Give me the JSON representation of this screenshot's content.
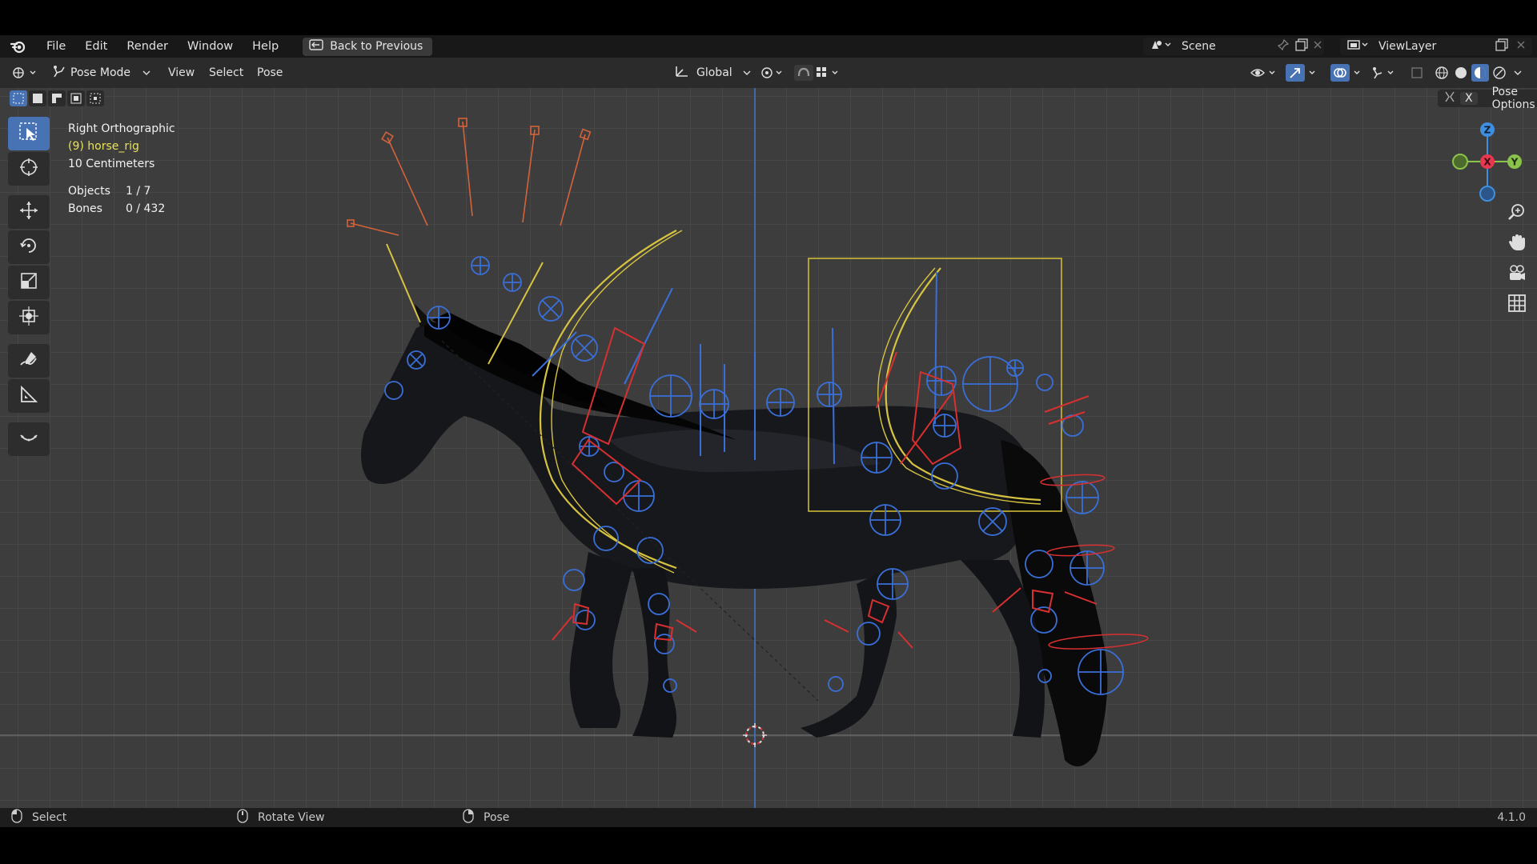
{
  "menubar": {
    "items": [
      "File",
      "Edit",
      "Render",
      "Window",
      "Help"
    ],
    "back_button": "Back to Previous",
    "scene": "Scene",
    "view_layer": "ViewLayer"
  },
  "header": {
    "mode": "Pose Mode",
    "menus": [
      "View",
      "Select",
      "Pose"
    ],
    "transform_orientation": "Global",
    "pose_options": "Pose Options",
    "x_toggle": "X"
  },
  "viewport": {
    "view_name": "Right Orthographic",
    "active_object": "(9) horse_rig",
    "scale": "10 Centimeters",
    "stats": [
      {
        "label": "Objects",
        "value": "1 / 7"
      },
      {
        "label": "Bones",
        "value": "0 / 432"
      }
    ]
  },
  "gizmo": {
    "z_label": "Z",
    "x_label": "X",
    "y_label": "Y"
  },
  "statusbar": {
    "select": "Select",
    "rotate_view": "Rotate View",
    "pose": "Pose",
    "version": "4.1.0"
  },
  "icons": {
    "toolbar": [
      "select-box-icon",
      "cursor-icon",
      "move-icon",
      "rotate-icon",
      "scale-icon",
      "transform-icon",
      "annotate-icon",
      "measure-icon",
      "relax-icon"
    ],
    "nav": [
      "zoom-icon",
      "pan-hand-icon",
      "camera-view-icon",
      "ortho-grid-icon"
    ]
  },
  "colors": {
    "active_blue": "#4772b3",
    "rig_yellow": "#e9e15a",
    "bone_blue": "#3a6fd8",
    "bone_red": "#d83030",
    "axis_z": "#3f8fe0",
    "axis_x": "#e8384f",
    "axis_y": "#8bc34a"
  }
}
